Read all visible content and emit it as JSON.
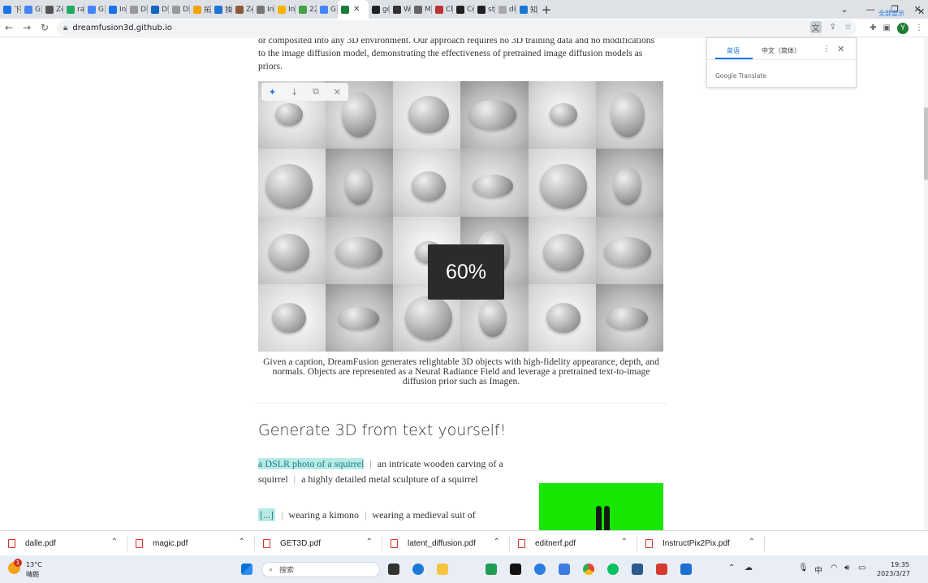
{
  "browser": {
    "tabs": [
      {
        "label": "下̇",
        "color": "#1a73e8"
      },
      {
        "label": "G Ac",
        "color": "#4285f4"
      },
      {
        "label": "Zer",
        "color": "#555"
      },
      {
        "label": "ran",
        "color": "#2a6"
      },
      {
        "label": "G Inc",
        "color": "#4285f4"
      },
      {
        "label": "Inc",
        "color": "#1a73e8"
      },
      {
        "label": "Dil",
        "color": "#999"
      },
      {
        "label": "Dil",
        "color": "#1565c0"
      },
      {
        "label": "Dil",
        "color": "#999"
      },
      {
        "label": "拓",
        "color": "#f4a100"
      },
      {
        "label": "独 孩",
        "color": "#1976d2"
      },
      {
        "label": "Zer",
        "color": "#8a5a3a"
      },
      {
        "label": "Ins",
        "color": "#777"
      },
      {
        "label": "Ins",
        "color": "#f4b400"
      },
      {
        "label": "22",
        "color": "#43a047"
      },
      {
        "label": "G dr",
        "color": "#4285f4"
      }
    ],
    "active_tab_label": "",
    "tabs_after": [
      {
        "label": "go",
        "color": "#222"
      },
      {
        "label": "W De",
        "color": "#333"
      },
      {
        "label": "Me",
        "color": "#666"
      },
      {
        "label": "Ch",
        "color": "#b33"
      },
      {
        "label": "Co",
        "color": "#222"
      },
      {
        "label": "ste",
        "color": "#222"
      },
      {
        "label": "dis",
        "color": "#aaa"
      },
      {
        "label": "知",
        "color": "#1976d2"
      }
    ],
    "new_tab": "+",
    "url": "dreamfusion3d.github.io"
  },
  "page": {
    "intro_text": "or composited into any 3D environment. Our approach requires no 3D training data and no modifications to the image diffusion model, demonstrating the effectiveness of pretrained image diffusion models as priors.",
    "zoom_level": "60%",
    "caption": "Given a caption, DreamFusion generates relightable 3D objects with high-fidelity appearance, depth, and normals. Objects are represented as a Neural Radiance Field and leverage a pretrained text-to-image diffusion prior such as Imagen.",
    "section_title": "Generate 3D from text yourself!",
    "prompt_options": [
      "a DSLR photo of a squirrel",
      "an intricate wooden carving of a squirrel",
      "a highly detailed metal sculpture of a squirrel"
    ],
    "modifier_options": [
      "[...]",
      "wearing a kimono",
      "wearing a medieval suit of"
    ],
    "preview_bg": "#19e600"
  },
  "translate_popup": {
    "tab_source": "英语",
    "tab_target": "中文（简体）",
    "brand_google": "Google",
    "brand_translate": "Translate"
  },
  "downloads": [
    {
      "name": "dalle.pdf"
    },
    {
      "name": "magic.pdf"
    },
    {
      "name": "GET3D.pdf"
    },
    {
      "name": "latent_diffusion.pdf"
    },
    {
      "name": "editnerf.pdf"
    },
    {
      "name": "InstructPix2Pix.pdf"
    }
  ],
  "show_all": "全部显示",
  "taskbar": {
    "weather_temp": "13°C",
    "weather_desc": "晴朗",
    "notif_count": "1",
    "search_placeholder": "搜索",
    "ime": "中",
    "time": "19:35",
    "date": "2023/3/27"
  }
}
